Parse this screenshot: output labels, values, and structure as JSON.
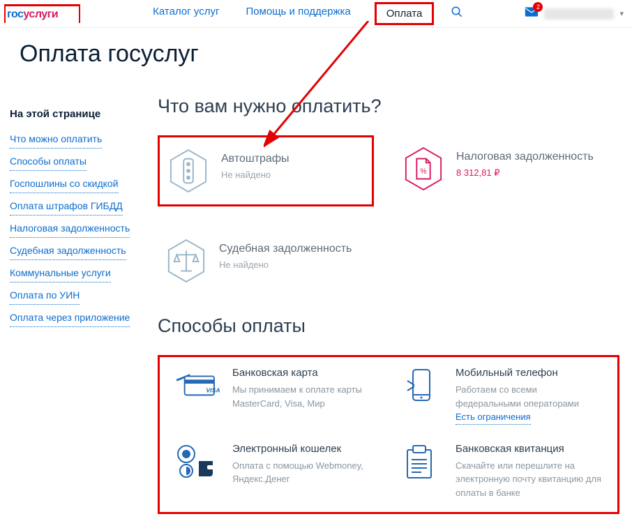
{
  "header": {
    "logo_part1": "гос",
    "logo_part2": "услуги",
    "nav": [
      {
        "label": "Каталог услуг"
      },
      {
        "label": "Помощь и поддержка"
      },
      {
        "label": "Оплата"
      }
    ],
    "mail_badge": "2"
  },
  "page_title": "Оплата госуслуг",
  "sidebar": {
    "title": "На этой странице",
    "items": [
      "Что можно оплатить",
      "Способы оплаты",
      "Госпошлины со скидкой",
      "Оплата штрафов ГИБДД",
      "Налоговая задолженность",
      "Судебная задолженность",
      "Коммунальные услуги",
      "Оплата по УИН",
      "Оплата через приложение"
    ]
  },
  "services": {
    "title": "Что вам нужно оплатить?",
    "items": [
      {
        "name": "Автоштрафы",
        "sub": "Не найдено"
      },
      {
        "name": "Налоговая задолженность",
        "sub": "8 312,81 ₽"
      },
      {
        "name": "Судебная задолженность",
        "sub": "Не найдено"
      }
    ]
  },
  "payment": {
    "title": "Способы оплаты",
    "methods": [
      {
        "name": "Банковская карта",
        "sub": "Мы принимаем к оплате карты MasterCard, Visa, Мир"
      },
      {
        "name": "Мобильный телефон",
        "sub": "Работаем со всеми федеральными операторами",
        "limit": "Есть ограничения"
      },
      {
        "name": "Электронный кошелек",
        "sub": "Оплата с помощью Webmoney, Яндекс.Денег"
      },
      {
        "name": "Банковская квитанция",
        "sub": "Скачайте или перешлите на электронную почту квитанцию для оплаты в банке"
      }
    ]
  }
}
